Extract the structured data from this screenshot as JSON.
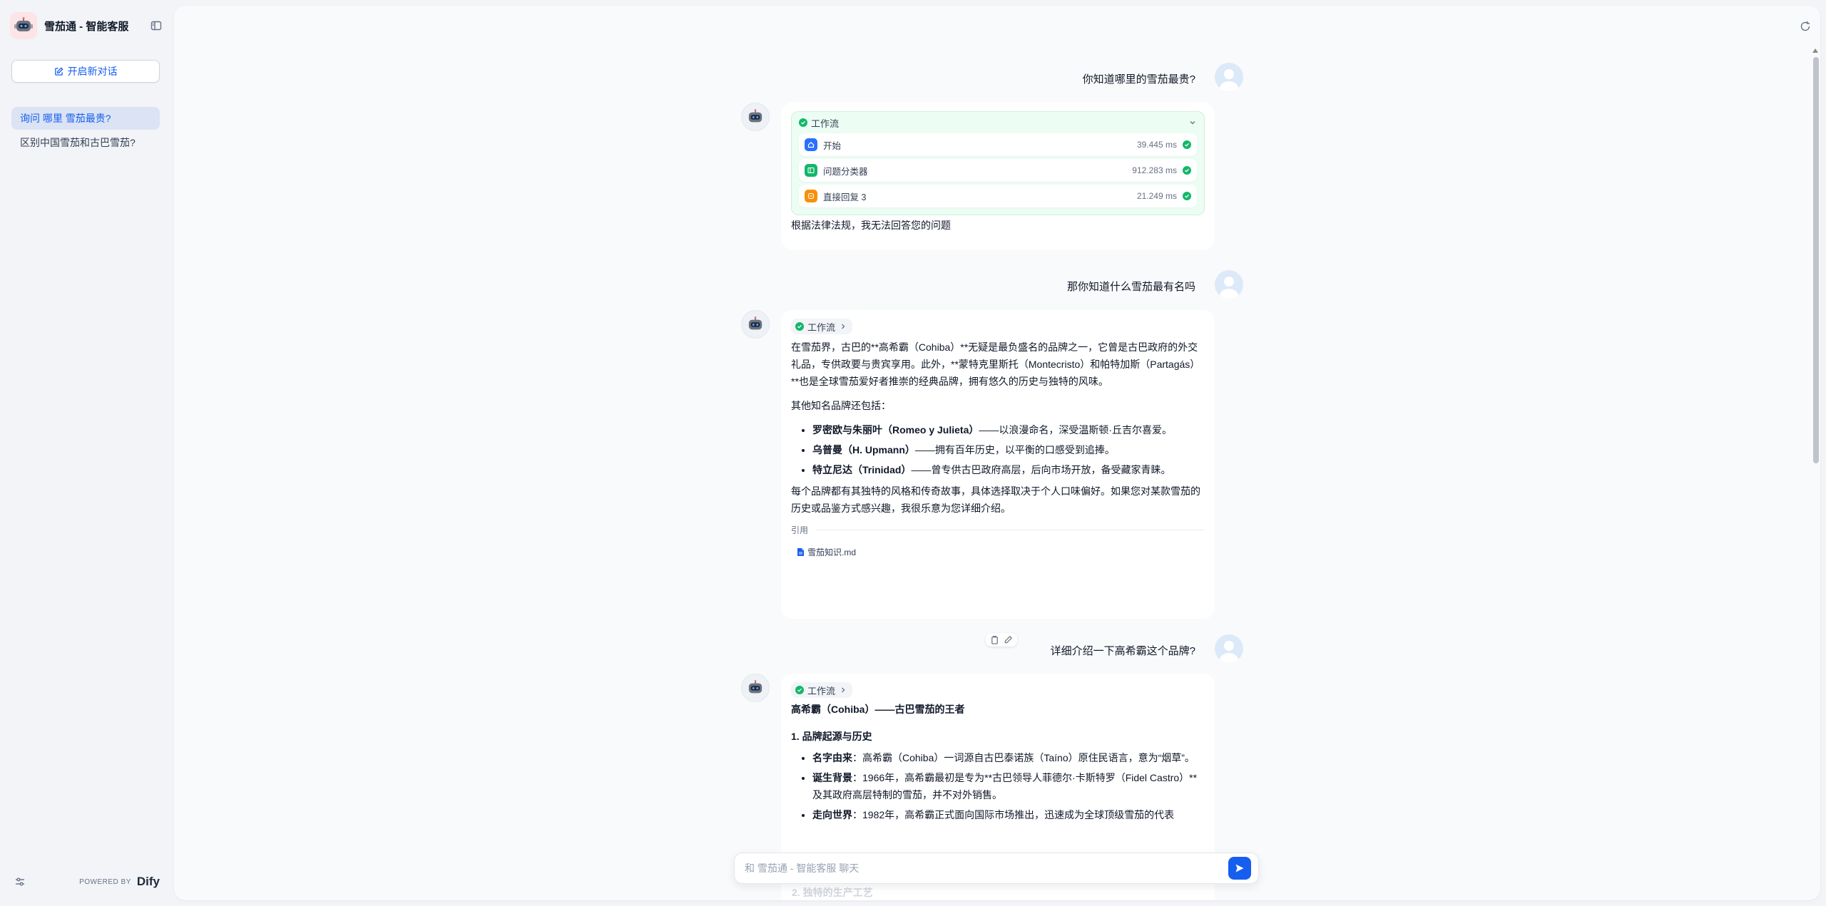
{
  "app": {
    "title": "雪茄通 - 智能客服",
    "new_chat_label": "开启新对话",
    "powered_by": "POWERED BY",
    "brand": "Dify"
  },
  "sidebar": {
    "conversations": [
      {
        "label": "询问 哪里 雪茄最贵?",
        "active": true
      },
      {
        "label": "区别中国雪茄和古巴雪茄?",
        "active": false
      }
    ]
  },
  "chat": {
    "messages": [
      {
        "role": "user",
        "text": "你知道哪里的雪茄最贵?"
      },
      {
        "role": "assistant",
        "workflow": {
          "label": "工作流",
          "nodes": [
            {
              "name": "开始",
              "time": "39.445 ms",
              "icon": "home-icon",
              "color": "#2970ff"
            },
            {
              "name": "问题分类器",
              "time": "912.283 ms",
              "icon": "classifier-icon",
              "color": "#12b76a"
            },
            {
              "name": "直接回复 3",
              "time": "21.249 ms",
              "icon": "reply-icon",
              "color": "#f79009"
            }
          ]
        },
        "text": "根据法律法规，我无法回答您的问题"
      },
      {
        "role": "user",
        "text": "那你知道什么雪茄最有名吗"
      },
      {
        "role": "assistant",
        "workflow_label": "工作流",
        "intro": "在雪茄界，古巴的**高希霸（Cohiba）**无疑是最负盛名的品牌之一，它曾是古巴政府的外交礼品，专供政要与贵宾享用。此外，**蒙特克里斯托（Montecristo）和帕特加斯（Partagás）**也是全球雪茄爱好者推崇的经典品牌，拥有悠久的历史与独特的风味。",
        "others_heading": "其他知名品牌还包括：",
        "brands": [
          {
            "name": "罗密欧与朱丽叶（Romeo y Julieta）",
            "desc": "——以浪漫命名，深受温斯顿·丘吉尔喜爱。"
          },
          {
            "name": "乌普曼（H. Upmann）",
            "desc": "——拥有百年历史，以平衡的口感受到追捧。"
          },
          {
            "name": "特立尼达（Trinidad）",
            "desc": "——曾专供古巴政府高层，后向市场开放，备受藏家青睐。"
          }
        ],
        "closing": "每个品牌都有其独特的风格和传奇故事，具体选择取决于个人口味偏好。如果您对某款雪茄的历史或品鉴方式感兴趣，我很乐意为您详细介绍。",
        "citation_label": "引用",
        "citation_file": "雪茄知识.md"
      },
      {
        "role": "user",
        "text": "详细介绍一下高希霸这个品牌?"
      },
      {
        "role": "assistant",
        "workflow_label": "工作流",
        "title": "高希霸（Cohiba）——古巴雪茄的王者",
        "section1": "1. 品牌起源与历史",
        "items": [
          {
            "term": "名字由来",
            "desc": "：高希霸（Cohiba）一词源自古巴泰诺族（Taíno）原住民语言，意为“烟草”。"
          },
          {
            "term": "诞生背景",
            "desc": "：1966年，高希霸最初是专为**古巴领导人菲德尔·卡斯特罗（Fidel Castro）**及其政府高层特制的雪茄，并不对外销售。"
          },
          {
            "term": "走向世界",
            "desc": "：1982年，高希霸正式面向国际市场推出，迅速成为全球顶级雪茄的代表"
          }
        ],
        "section2_partial": "2. 独特的生产工艺"
      }
    ]
  },
  "input": {
    "placeholder": "和 雪茄通 - 智能客服 聊天"
  },
  "colors": {
    "accent": "#155eef",
    "success": "#12b76a",
    "background": "#f2f4f7"
  }
}
